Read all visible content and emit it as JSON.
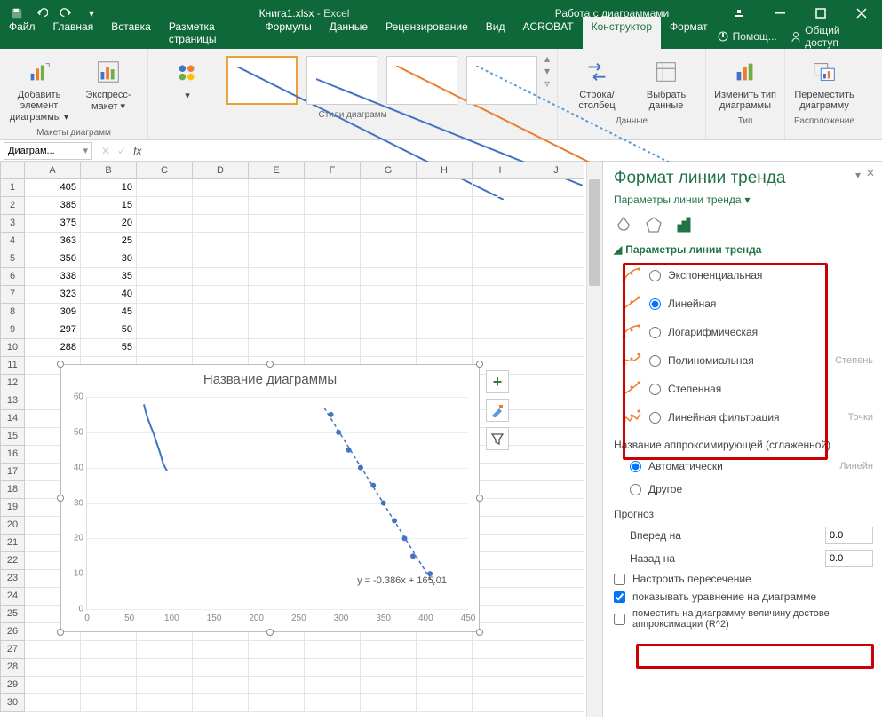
{
  "titlebar": {
    "filename": "Книга1.xlsx",
    "app": "Excel",
    "context": "Работа с диаграммами"
  },
  "tabs": [
    "Файл",
    "Главная",
    "Вставка",
    "Разметка страницы",
    "Формулы",
    "Данные",
    "Рецензирование",
    "Вид",
    "ACROBAT",
    "Конструктор",
    "Формат"
  ],
  "tabs_active": "Конструктор",
  "tell_me": "Помощ...",
  "share": "Общий доступ",
  "ribbon": {
    "groups": {
      "layouts": {
        "name": "Макеты диаграмм",
        "btn1": "Добавить элемент диаграммы",
        "btn2": "Экспресс-макет"
      },
      "styles_label": "Стили диаграмм",
      "colors": "Изменить цвета",
      "data": {
        "name": "Данные",
        "btn1": "Строка/столбец",
        "btn2": "Выбрать данные"
      },
      "type": {
        "name": "Тип",
        "btn": "Изменить тип диаграммы"
      },
      "location": {
        "name": "Расположение",
        "btn": "Переместить диаграмму"
      }
    }
  },
  "namebox": "Диаграм...",
  "columns": [
    "A",
    "B",
    "C",
    "D",
    "E",
    "F",
    "G",
    "H",
    "I",
    "J"
  ],
  "sheet_data": [
    {
      "r": 1,
      "a": 405,
      "b": 10
    },
    {
      "r": 2,
      "a": 385,
      "b": 15
    },
    {
      "r": 3,
      "a": 375,
      "b": 20
    },
    {
      "r": 4,
      "a": 363,
      "b": 25
    },
    {
      "r": 5,
      "a": 350,
      "b": 30
    },
    {
      "r": 6,
      "a": 338,
      "b": 35
    },
    {
      "r": 7,
      "a": 323,
      "b": 40
    },
    {
      "r": 8,
      "a": 309,
      "b": 45
    },
    {
      "r": 9,
      "a": 297,
      "b": 50
    },
    {
      "r": 10,
      "a": 288,
      "b": 55
    }
  ],
  "empty_rows": [
    11,
    12,
    13,
    14,
    15,
    16,
    17,
    18,
    19,
    20,
    21,
    22,
    23,
    24,
    25,
    26,
    27,
    28,
    29,
    30
  ],
  "chart": {
    "title": "Название диаграммы",
    "equation": "y = -0.386x + 165.01"
  },
  "chart_data": {
    "type": "scatter",
    "title": "Название диаграммы",
    "x": [
      288,
      297,
      309,
      323,
      338,
      350,
      363,
      375,
      385,
      405
    ],
    "y": [
      55,
      50,
      45,
      40,
      35,
      30,
      25,
      20,
      15,
      10
    ],
    "xlim": [
      0,
      450
    ],
    "ylim": [
      0,
      60
    ],
    "xticks": [
      0,
      50,
      100,
      150,
      200,
      250,
      300,
      350,
      400,
      450
    ],
    "yticks": [
      0,
      10,
      20,
      30,
      40,
      50,
      60
    ],
    "trendline": {
      "type": "linear",
      "equation": "y = -0.386x + 165.01",
      "slope": -0.386,
      "intercept": 165.01,
      "show_equation": true
    }
  },
  "pane": {
    "title": "Формат линии тренда",
    "subtitle": "Параметры линии тренда",
    "section": "Параметры линии тренда",
    "options": [
      {
        "label": "Экспоненциальная",
        "sel": false
      },
      {
        "label": "Линейная",
        "sel": true
      },
      {
        "label": "Логарифмическая",
        "sel": false
      },
      {
        "label": "Полиномиальная",
        "sel": false,
        "side": "Степень"
      },
      {
        "label": "Степенная",
        "sel": false
      },
      {
        "label": "Линейная фильтрация",
        "sel": false,
        "side": "Точки"
      }
    ],
    "name_label": "Название аппроксимирующей (сглаженной)",
    "name_auto": "Автоматически",
    "name_auto_side": "Линейн",
    "name_other": "Другое",
    "forecast": "Прогноз",
    "forward": "Вперед на",
    "backward": "Назад на",
    "forward_val": "0.0",
    "backward_val": "0.0",
    "set_intercept": "Настроить пересечение",
    "show_eq": "показывать уравнение на диаграмме",
    "show_r2": "поместить на диаграмму величину достове аппроксимации (R^2)"
  }
}
